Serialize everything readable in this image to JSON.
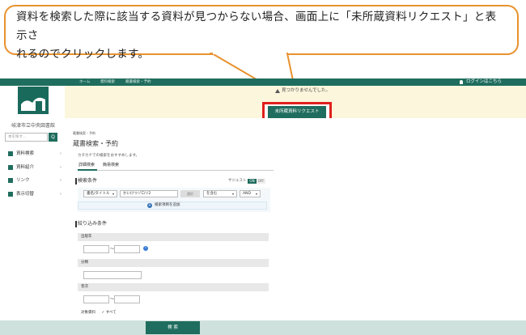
{
  "callout": {
    "line1": "資料を検索した際に該当する資料が見つからない場合、画面上に「未所蔵資料リクエスト」と表示さ",
    "line2": "れるのでクリックします。"
  },
  "topnav": {
    "home": "ホーム",
    "search": "資料検索",
    "subsearch": "蔵書検索・予約"
  },
  "login": "ログインはこちら",
  "library_name": "岐津市立中央図書館",
  "side_search_placeholder": "本を探す...",
  "side_search_button": "Q",
  "sidebar": [
    {
      "label": "資料検索"
    },
    {
      "label": "資料紹介"
    },
    {
      "label": "リンク"
    },
    {
      "label": "表示切替"
    }
  ],
  "notice": "見つかりませんでした。",
  "request_button": "未所蔵資料リクエスト",
  "breadcrumb": "蔵書検索・予約",
  "page_title": "蔵書検索・予約",
  "hint": "カタカナでの検索をおすすめします。",
  "tabs": [
    "詳細検索",
    "簡易検索"
  ],
  "search_conditions": {
    "heading": "検索条件",
    "suggest_label": "サジェスト",
    "toggle_on": "ON",
    "toggle_off": "OFF",
    "field_select": "書名/タイトル",
    "keyword_value": "かいけつゾロリ2",
    "clear_button": "選択",
    "match_select": "を含む",
    "logic_select": "AND",
    "add_condition": "検索項目を追加"
  },
  "filter": {
    "heading": "絞り込み条件",
    "year_label": "出版年",
    "class_label": "分類",
    "series_label": "巻次",
    "target_label": "対象資料",
    "target_value": "✓ すべて",
    "range_dash": "〜",
    "info_icon_text": "i"
  },
  "search_button": "検 索",
  "colors": {
    "accent": "#1f6d5e",
    "highlight": "#e0201c",
    "callout_border": "#e8922e"
  }
}
